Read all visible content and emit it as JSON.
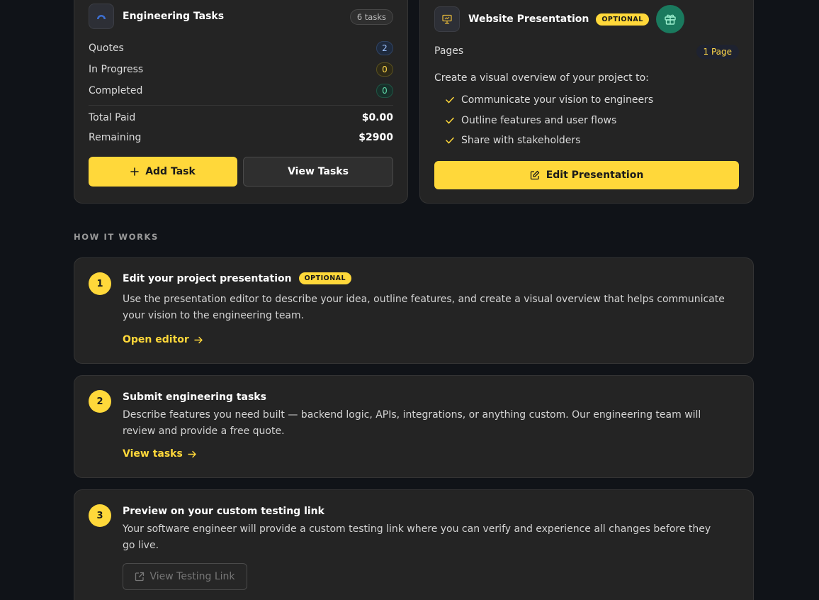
{
  "tasks_card": {
    "title": "Engineering Tasks",
    "count_label": "6 tasks",
    "icon": "app-icon",
    "stats": [
      {
        "label": "Quotes",
        "value": "2"
      },
      {
        "label": "In Progress",
        "value": "0"
      },
      {
        "label": "Completed",
        "value": "0"
      }
    ],
    "total_paid_label": "Total Paid",
    "total_paid_value": "$0.00",
    "remaining_label": "Remaining",
    "remaining_value": "$2900",
    "add_task_label": "Add Task",
    "view_tasks_label": "View Tasks"
  },
  "presentation_card": {
    "title": "Website Presentation",
    "optional_label": "OPTIONAL",
    "icon": "presentation-icon",
    "pages_label": "Pages",
    "pages_count": "1 Page",
    "intro": "Create a visual overview of your project to:",
    "checklist": [
      "Communicate your vision to engineers",
      "Outline features and user flows",
      "Share with stakeholders"
    ],
    "edit_label": "Edit Presentation"
  },
  "how_it_works": {
    "label": "HOW IT WORKS",
    "steps": [
      {
        "number": "1",
        "title": "Edit your project presentation",
        "badge": "OPTIONAL",
        "description": "Use the presentation editor to describe your idea, outline features, and create a visual overview that helps communicate your vision to the engineering team.",
        "link": "Open editor"
      },
      {
        "number": "2",
        "title": "Submit engineering tasks",
        "description": "Describe features you need built — backend logic, APIs, integrations, or anything custom. Our engineering team will review and provide a free quote.",
        "link": "View tasks"
      },
      {
        "number": "3",
        "title": "Preview on your custom testing link",
        "description": "Your software engineer will provide a custom testing link where you can verify and experience all changes before they go live.",
        "button": "View Testing Link"
      }
    ]
  },
  "colors": {
    "accent": "#ffd83a",
    "background": "#101318",
    "card": "#242424",
    "gift": "#1a7a5e"
  }
}
